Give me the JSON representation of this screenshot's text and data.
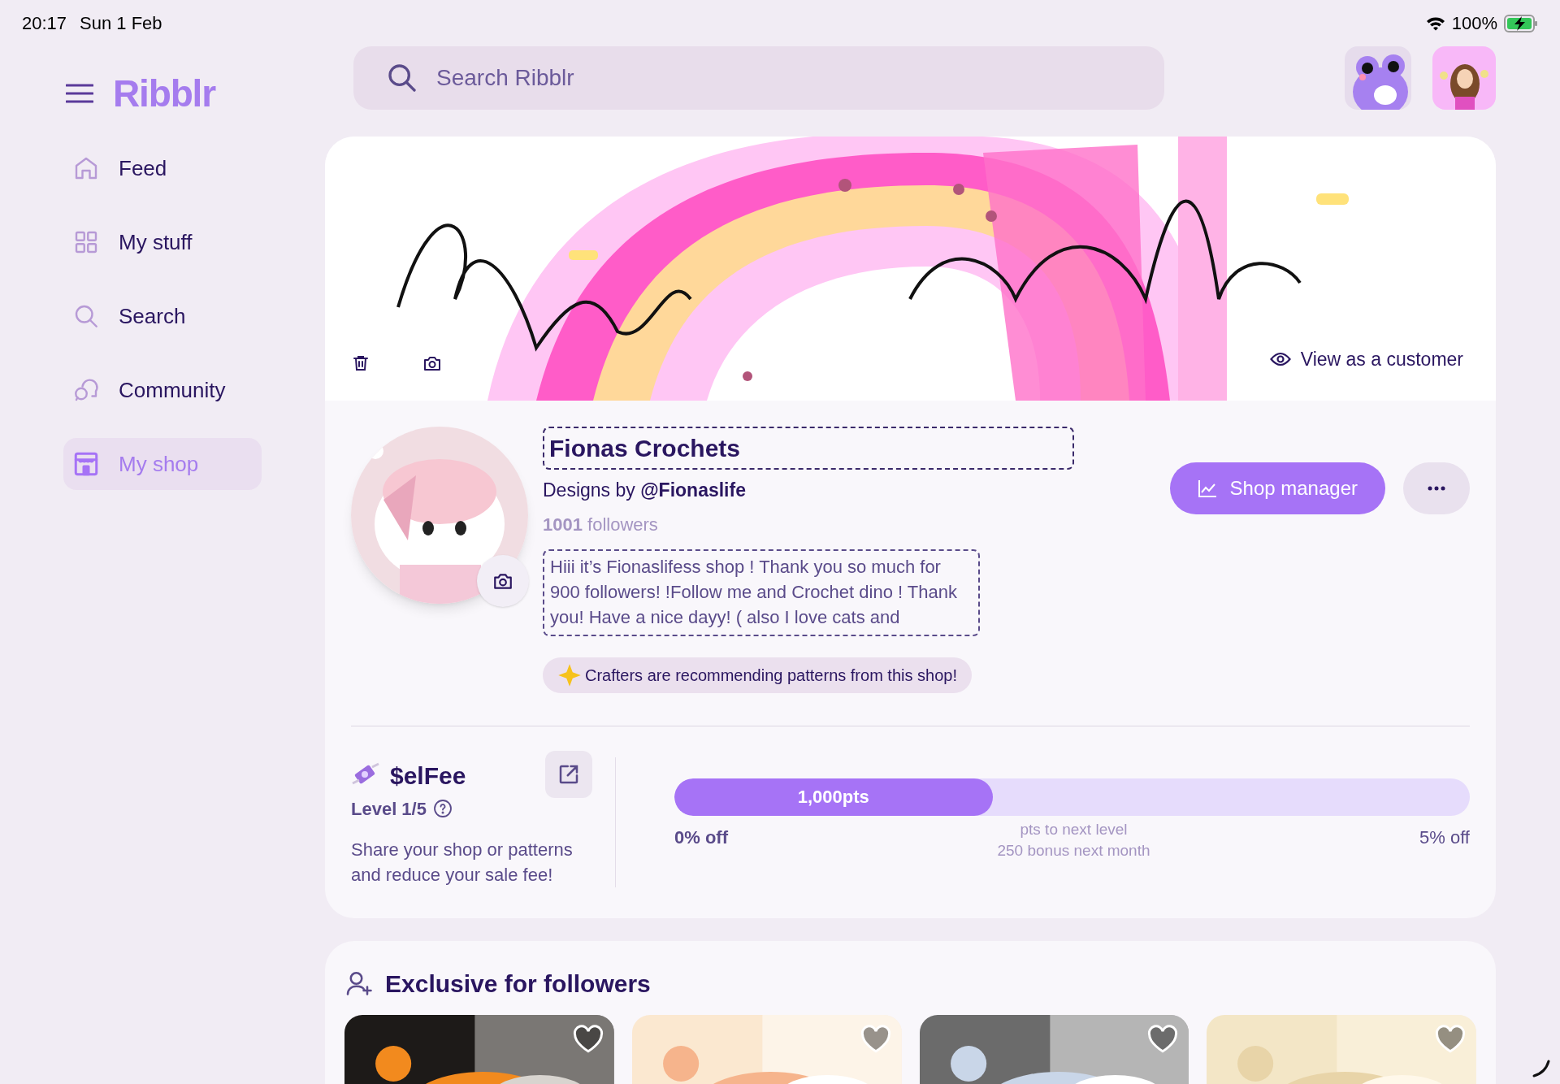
{
  "status_bar": {
    "time": "20:17",
    "date": "Sun 1 Feb",
    "battery": "100%"
  },
  "app": {
    "logo": "Ribblr"
  },
  "sidebar": {
    "items": [
      {
        "label": "Feed",
        "kind": "home",
        "selected": false
      },
      {
        "label": "My stuff",
        "kind": "grid",
        "selected": false
      },
      {
        "label": "Search",
        "kind": "search",
        "selected": false
      },
      {
        "label": "Community",
        "kind": "chat",
        "selected": false
      },
      {
        "label": "My shop",
        "kind": "shop",
        "selected": true
      }
    ]
  },
  "search": {
    "placeholder": "Search Ribblr"
  },
  "banner": {
    "view_link": "View as a customer"
  },
  "shop": {
    "name": "Fionas Crochets",
    "designer": "Designs by **@Fionaslife**",
    "followers": "**1001** followers",
    "description": "Hiii it’s Fionaslifess shop ! Thank you so much for 900 followers! !Follow me and Crochet dino ! Thank you! Have a nice dayy! ( also I love cats and",
    "recommendation": "Crafters are recommending patterns from this shop!",
    "manager_button": "Shop manager"
  },
  "selfee": {
    "title": "$elFee",
    "level_label": "Level 1/5",
    "description": "Share your shop or patterns and reduce your sale fee!",
    "progress": {
      "level": 0.4,
      "reading": "1,000pts"
    },
    "start_label": "0% off",
    "note": "pts to next level",
    "bonus": "250 bonus next month",
    "end_label": "5% off"
  },
  "exclusive": {
    "title": "Exclusive for followers"
  }
}
